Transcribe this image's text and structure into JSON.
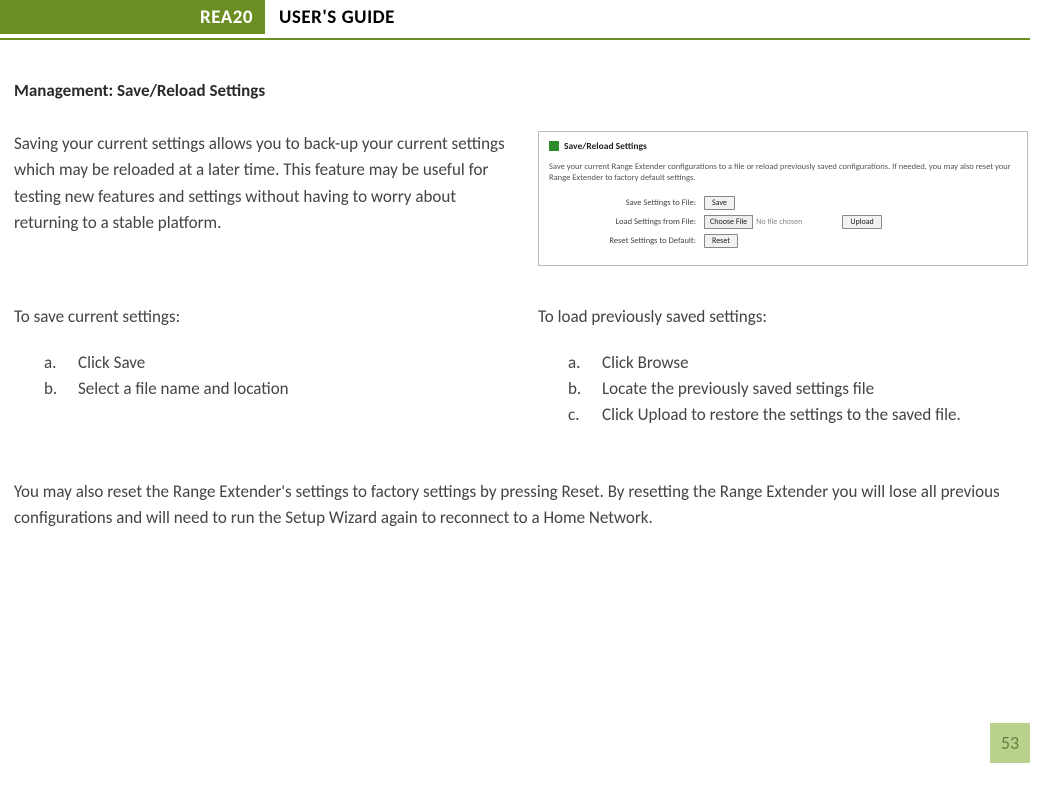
{
  "header": {
    "brand": "REA20",
    "title": "USER'S GUIDE"
  },
  "section_heading": "Management: Save/Reload Settings",
  "intro_para": "Saving your current settings allows you to back-up your current settings which may be reloaded at a later time. This feature may be useful for testing new features and settings without having to worry about returning to a stable platform.",
  "screenshot": {
    "title": "Save/Reload Settings",
    "desc": "Save your current Range Extender configurations to a file or reload previously saved configurations. If needed, you may also reset your Range Extender to factory default settings.",
    "row1_label": "Save Settings to File:",
    "row1_btn": "Save",
    "row2_label": "Load Settings from File:",
    "row2_choose": "Choose File",
    "row2_nofile": "No file chosen",
    "row2_upload": "Upload",
    "row3_label": "Reset Settings to Default:",
    "row3_btn": "Reset"
  },
  "save": {
    "heading": "To save current settings:",
    "steps": [
      {
        "m": "a.",
        "t": "Click Save"
      },
      {
        "m": "b.",
        "t": "Select a file name and location"
      }
    ]
  },
  "load": {
    "heading": "To load previously saved settings:",
    "steps": [
      {
        "m": "a.",
        "t": "Click Browse"
      },
      {
        "m": "b.",
        "t": "Locate the previously saved settings file"
      },
      {
        "m": "c.",
        "t": "Click Upload to restore the settings to the saved file."
      }
    ]
  },
  "reset_para": "You may also reset the Range Extender's settings to factory settings by pressing Reset. By resetting the Range Extender you will lose all previous configurations and will need to run the Setup Wizard again to reconnect to a Home Network.",
  "page_number": "53"
}
